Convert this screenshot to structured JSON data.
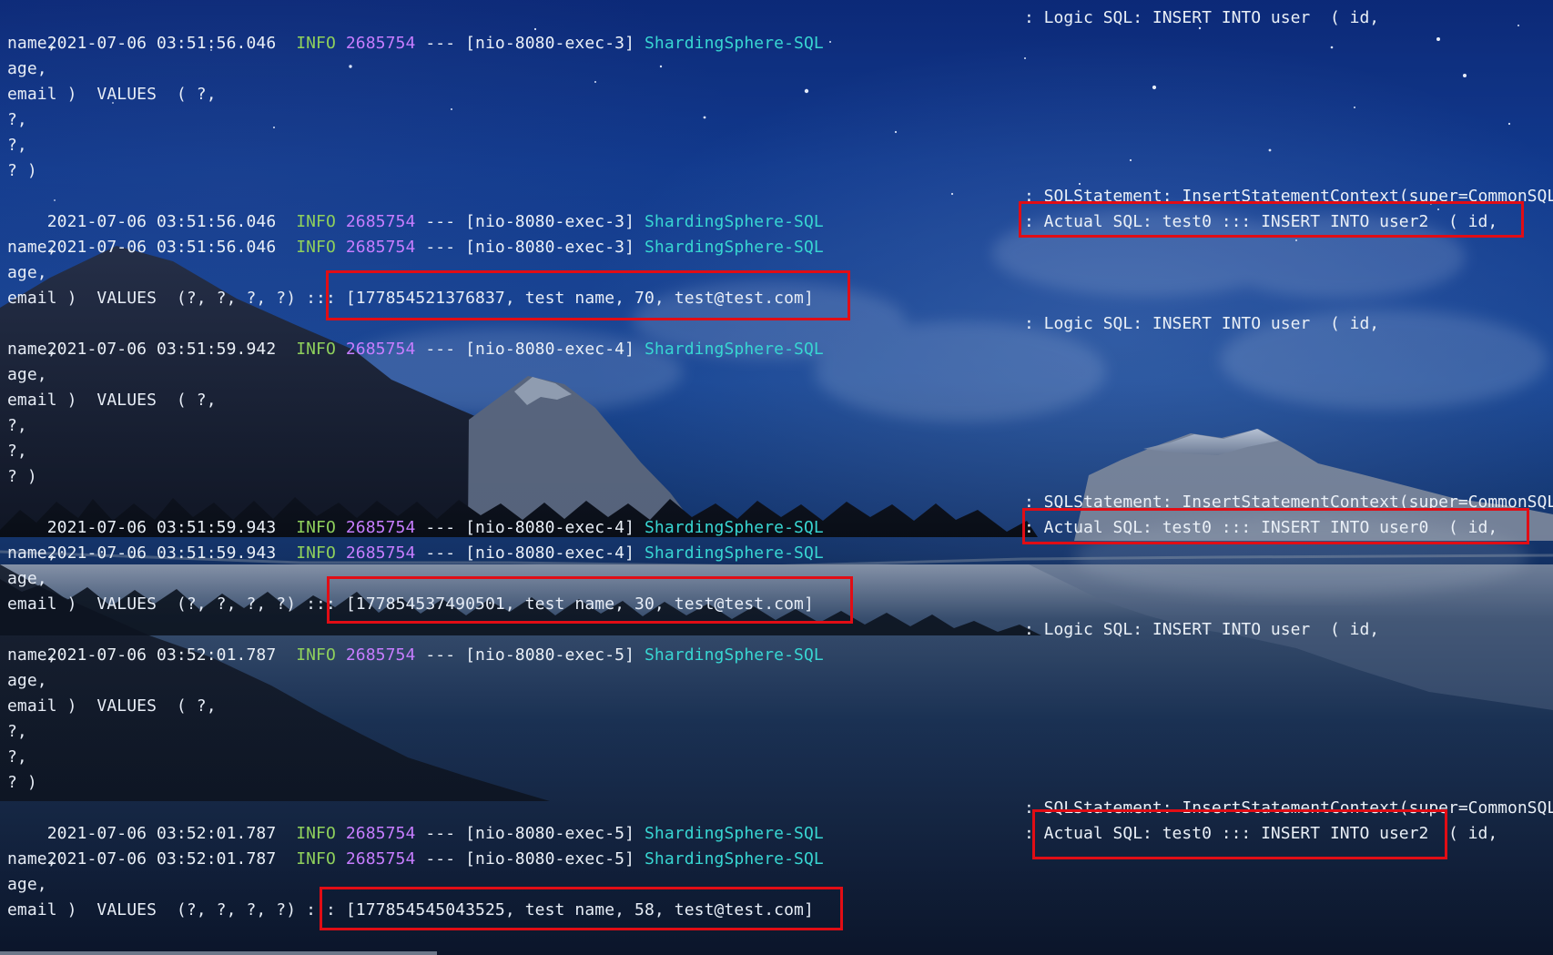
{
  "terminal": {
    "log_entries": [
      {
        "timestamp": "2021-07-06 03:51:56.046",
        "level": "INFO",
        "pid": "2685754",
        "separator": "---",
        "thread": "[nio-8080-exec-3]",
        "logger": "ShardingSphere-SQL",
        "message": ": Logic SQL: INSERT INTO user  ( id,"
      },
      {
        "timestamp": "2021-07-06 03:51:56.046",
        "level": "INFO",
        "pid": "2685754",
        "separator": "---",
        "thread": "[nio-8080-exec-3]",
        "logger": "ShardingSphere-SQL",
        "message": ": SQLStatement: InsertStatementContext(super=CommonSQL"
      },
      {
        "timestamp": "2021-07-06 03:51:56.046",
        "level": "INFO",
        "pid": "2685754",
        "separator": "---",
        "thread": "[nio-8080-exec-3]",
        "logger": "ShardingSphere-SQL",
        "message": ": Actual SQL: test0 ::: INSERT INTO user2  ( id,"
      },
      {
        "timestamp": "2021-07-06 03:51:59.942",
        "level": "INFO",
        "pid": "2685754",
        "separator": "---",
        "thread": "[nio-8080-exec-4]",
        "logger": "ShardingSphere-SQL",
        "message": ": Logic SQL: INSERT INTO user  ( id,"
      },
      {
        "timestamp": "2021-07-06 03:51:59.943",
        "level": "INFO",
        "pid": "2685754",
        "separator": "---",
        "thread": "[nio-8080-exec-4]",
        "logger": "ShardingSphere-SQL",
        "message": ": SQLStatement: InsertStatementContext(super=CommonSQL"
      },
      {
        "timestamp": "2021-07-06 03:51:59.943",
        "level": "INFO",
        "pid": "2685754",
        "separator": "---",
        "thread": "[nio-8080-exec-4]",
        "logger": "ShardingSphere-SQL",
        "message": ": Actual SQL: test0 ::: INSERT INTO user0  ( id,"
      },
      {
        "timestamp": "2021-07-06 03:52:01.787",
        "level": "INFO",
        "pid": "2685754",
        "separator": "---",
        "thread": "[nio-8080-exec-5]",
        "logger": "ShardingSphere-SQL",
        "message": ": Logic SQL: INSERT INTO user  ( id,"
      },
      {
        "timestamp": "2021-07-06 03:52:01.787",
        "level": "INFO",
        "pid": "2685754",
        "separator": "---",
        "thread": "[nio-8080-exec-5]",
        "logger": "ShardingSphere-SQL",
        "message": ": SQLStatement: InsertStatementContext(super=CommonSQL"
      },
      {
        "timestamp": "2021-07-06 03:52:01.787",
        "level": "INFO",
        "pid": "2685754",
        "separator": "---",
        "thread": "[nio-8080-exec-5]",
        "logger": "ShardingSphere-SQL",
        "message": ": Actual SQL: test0 ::: INSERT INTO user2  ( id,"
      }
    ],
    "continuations": [
      "name,",
      "age,",
      "email )  VALUES  ( ?,",
      "?,",
      "?,",
      "? )",
      "name,",
      "age,",
      "email )  VALUES  (?, ?, ?, ?) ::: [177854521376837, test name, 70, test@test.com]",
      "name,",
      "age,",
      "email )  VALUES  ( ?,",
      "?,",
      "?,",
      "? )",
      "name,",
      "age,",
      "email )  VALUES  (?, ?, ?, ?) ::: [177854537490501, test name, 30, test@test.com]",
      "name,",
      "age,",
      "email )  VALUES  ( ?,",
      "?,",
      "?,",
      "? )",
      "name,",
      "age,",
      "email )  VALUES  (?, ?, ?, ?) ::: [177854545043525, test name, 58, test@test.com]"
    ]
  },
  "colors": {
    "background_top": "#0c2a7a",
    "text": "#eaf0f7",
    "info": "#8fd05c",
    "pid": "#c77dff",
    "logger": "#38d6d2",
    "highlight": "#e10d15"
  },
  "icons": {
    "wallpaper": "night-sky-mountain-lake-background"
  }
}
